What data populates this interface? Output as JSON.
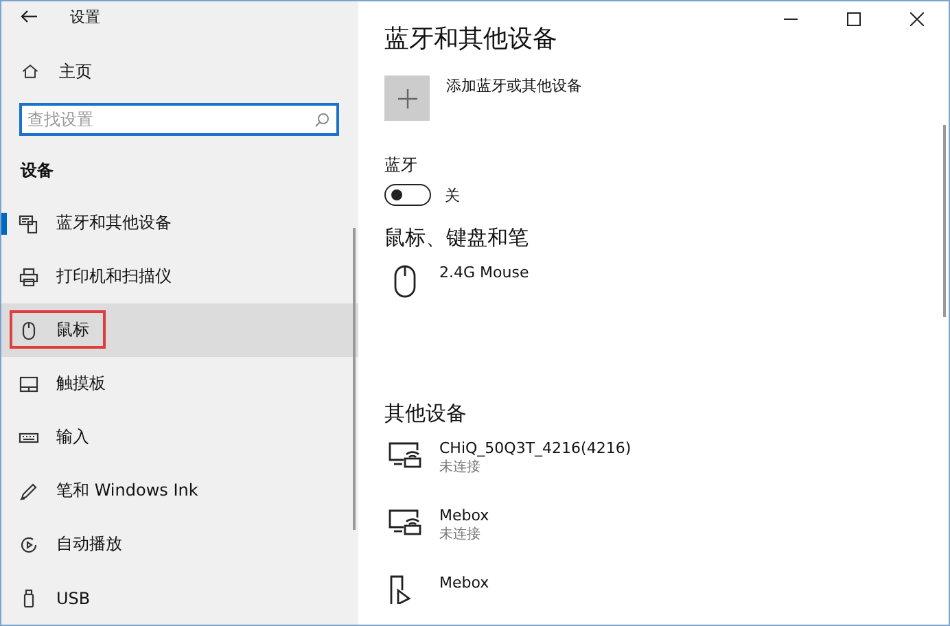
{
  "window": {
    "title": "设置"
  },
  "sidebar": {
    "home": "主页",
    "search": {
      "placeholder": "查找设置"
    },
    "heading": "设备",
    "items": [
      {
        "label": "蓝牙和其他设备",
        "kind": "devices",
        "selected": true,
        "hovered": false,
        "outlined": false
      },
      {
        "label": "打印机和扫描仪",
        "kind": "printer",
        "selected": false,
        "hovered": false,
        "outlined": false
      },
      {
        "label": "鼠标",
        "kind": "mouse",
        "selected": false,
        "hovered": true,
        "outlined": true
      },
      {
        "label": "触摸板",
        "kind": "touchpad",
        "selected": false,
        "hovered": false,
        "outlined": false
      },
      {
        "label": "输入",
        "kind": "keyboard",
        "selected": false,
        "hovered": false,
        "outlined": false
      },
      {
        "label": "笔和 Windows Ink",
        "kind": "pen",
        "selected": false,
        "hovered": false,
        "outlined": false
      },
      {
        "label": "自动播放",
        "kind": "autoplay",
        "selected": false,
        "hovered": false,
        "outlined": false
      },
      {
        "label": "USB",
        "kind": "usb",
        "selected": false,
        "hovered": false,
        "outlined": false
      }
    ]
  },
  "content": {
    "title": "蓝牙和其他设备",
    "add_button": "添加蓝牙或其他设备",
    "bluetooth": {
      "label": "蓝牙",
      "on": false,
      "state_text": "关"
    },
    "sections": [
      {
        "heading": "鼠标、键盘和笔",
        "devices": [
          {
            "name": "2.4G Mouse",
            "kind": "mouse"
          }
        ]
      },
      {
        "heading": "其他设备",
        "devices": [
          {
            "name": "CHiQ_50Q3T_4216(4216)",
            "status": "未连接",
            "kind": "display"
          },
          {
            "name": "Mebox",
            "status": "未连接",
            "kind": "display"
          },
          {
            "name": "Mebox",
            "kind": "media"
          }
        ]
      }
    ]
  }
}
